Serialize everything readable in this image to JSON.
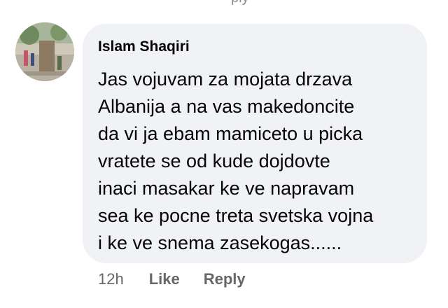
{
  "comment": {
    "author": "Islam Shaqiri",
    "text_lines": [
      "Jas vojuvam za mojata drzava",
      "Albanija a na vas makedoncite",
      "da vi ja ebam mamiceto u picka",
      "vratete se od kude dojdovte",
      "inaci masakar ke ve napravam",
      "sea ke pocne treta svetska vojna",
      "i ke ve snema zasekogas......"
    ],
    "timestamp": "12h",
    "like_label": "Like",
    "reply_label": "Reply"
  },
  "previous_comment": {
    "reply_stub": "ply"
  },
  "icons": {
    "avatar": "profile-photo"
  },
  "colors": {
    "bubble_bg": "#f0f2f5",
    "text": "#050505",
    "meta": "#65676b"
  }
}
